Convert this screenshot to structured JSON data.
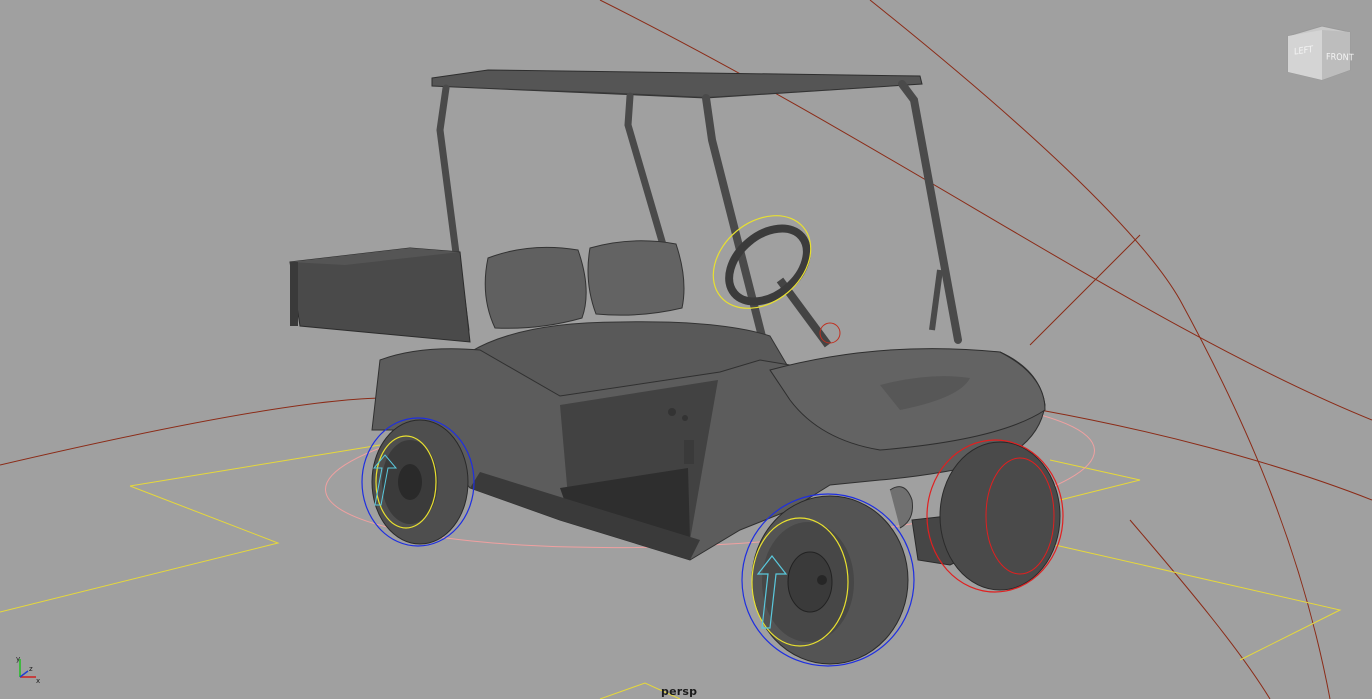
{
  "viewport": {
    "camera": "persp",
    "background": "#a0a0a0",
    "grid_color": "#8b2b17",
    "footprint_color": "#e6d83a"
  },
  "viewcube": {
    "left_label": "LEFT",
    "front_label": "FRONT"
  },
  "axis_triad": {
    "x_label": "x",
    "y_label": "y",
    "z_label": "z",
    "x_color": "#d02020",
    "y_color": "#20c020",
    "z_color": "#2040d0"
  },
  "model": {
    "body_color": "#5a5a5a",
    "dark_color": "#3f3f3f",
    "controls": {
      "wheel_control_color": "#1e2ee0",
      "ring_control_color": "#e8e030",
      "rear_right_control_color": "#e02020",
      "main_control_color": "#f0a0a0",
      "lift_arrow_color": "#5ac8dc"
    }
  }
}
